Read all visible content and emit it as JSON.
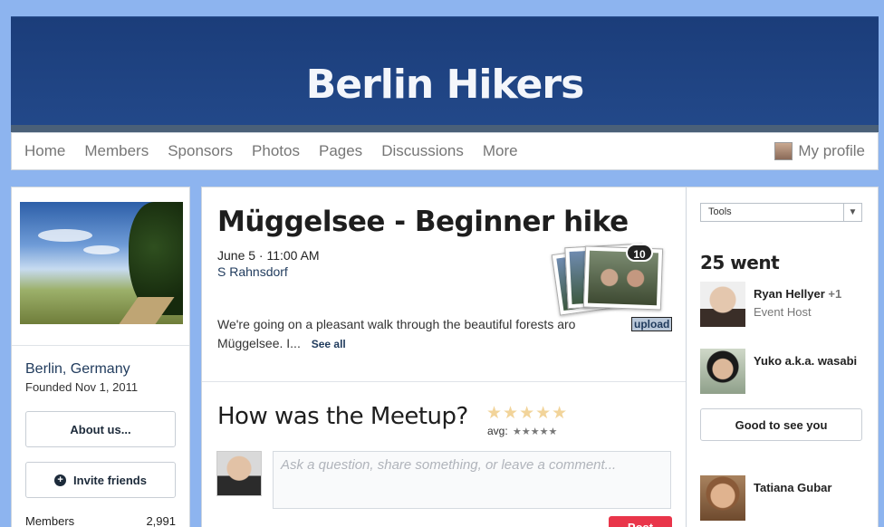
{
  "group": {
    "name": "Berlin Hikers",
    "city": "Berlin, Germany",
    "founded": "Founded Nov 1, 2011",
    "members_label": "Members",
    "members_count": "2,991"
  },
  "nav": {
    "items": [
      "Home",
      "Members",
      "Sponsors",
      "Photos",
      "Pages",
      "Discussions",
      "More"
    ],
    "profile_label": "My profile"
  },
  "sidebar": {
    "about_label": "About us...",
    "invite_label": "Invite friends",
    "invite_icon": "+"
  },
  "event": {
    "title": "Müggelsee - Beginner hike",
    "datetime": "June 5 · 11:00 AM",
    "location": "S Rahnsdorf",
    "description": "We're going on a pleasant walk through the beautiful forests aro",
    "description_cont": "Müggelsee. I...",
    "see_all": "See all",
    "upload_label": "upload",
    "photo_count": "10"
  },
  "feedback": {
    "heading": "How was the Meetup?",
    "stars": "★★★★★",
    "avg_label": "avg:",
    "avg_stars": "★★★★★",
    "comment_placeholder": "Ask a question, share something, or leave a comment...",
    "post_label": "Post"
  },
  "rsvp": {
    "tools_label": "Tools",
    "went_label": "25 went",
    "good_to_see_label": "Good to see you",
    "attendees": [
      {
        "name": "Ryan Hellyer",
        "extra": "+1",
        "role": "Event Host"
      },
      {
        "name": "Yuko a.k.a. wasabi"
      },
      {
        "name": "Tatiana Gubar"
      }
    ]
  },
  "colors": {
    "background": "#8db4ef",
    "banner": "#1f4381",
    "accent_post": "#e9354a",
    "link": "#1f3a5c"
  }
}
